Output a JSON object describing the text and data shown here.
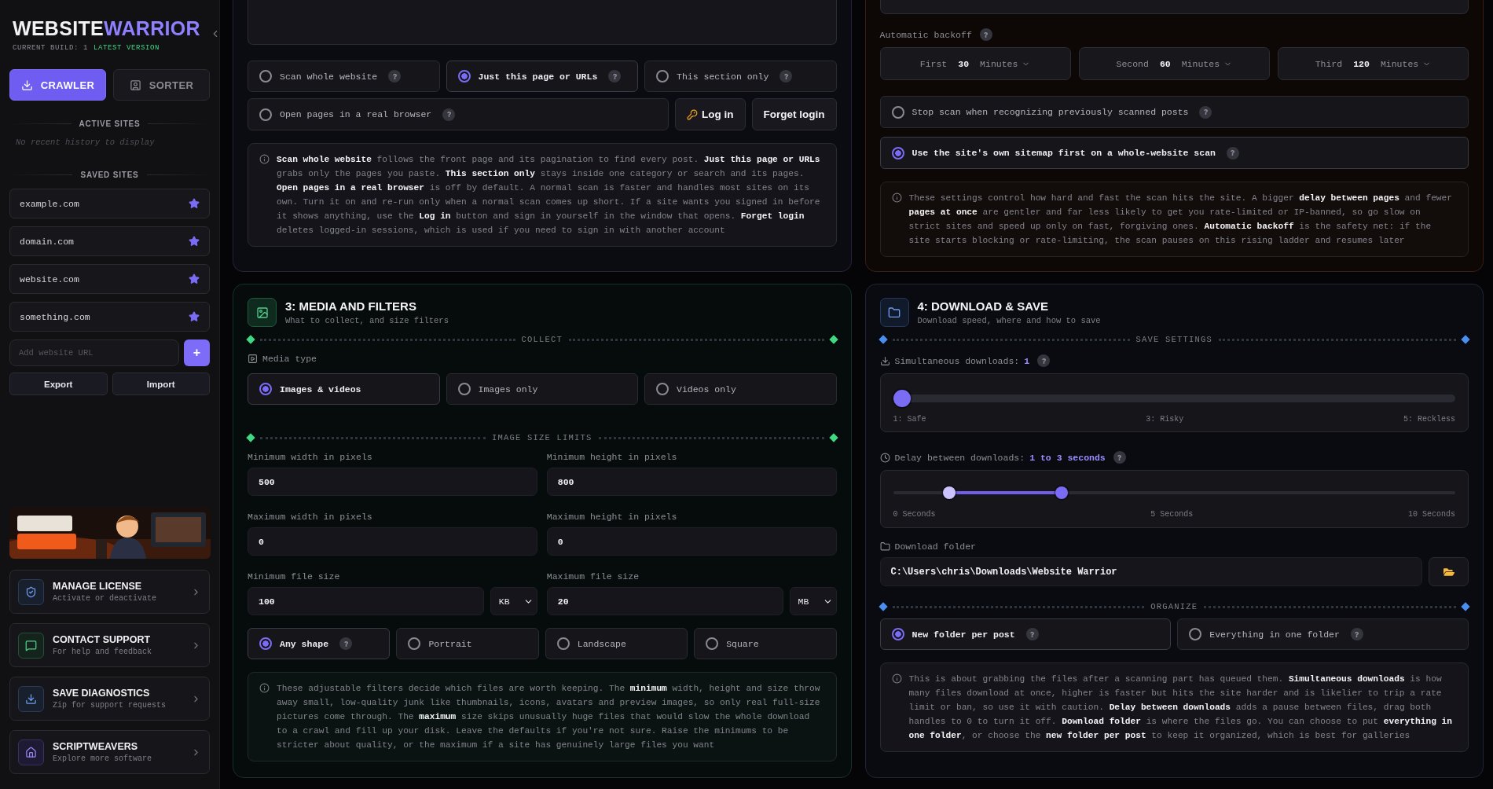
{
  "sidebar": {
    "brand": {
      "first": "WEBSITE",
      "second": "WARRIOR"
    },
    "build": {
      "label": "CURRENT BUILD: 1",
      "status": "LATEST VERSION"
    },
    "modes": [
      {
        "label": "CRAWLER",
        "kind": "crawler",
        "selected": true
      },
      {
        "label": "SORTER",
        "kind": "sorter",
        "selected": false
      }
    ],
    "active_sites": {
      "heading": "ACTIVE SITES",
      "empty_message": "No recent history to display"
    },
    "saved_sites": {
      "heading": "SAVED SITES",
      "items": [
        {
          "name": "example.com"
        },
        {
          "name": "domain.com"
        },
        {
          "name": "website.com"
        },
        {
          "name": "something.com"
        }
      ]
    },
    "add_site": {
      "placeholder": "Add website URL",
      "button": "+"
    },
    "actions": [
      "Export",
      "Import"
    ],
    "links": [
      {
        "kind": "license",
        "title": "MANAGE LICENSE",
        "subtitle": "Activate or deactivate"
      },
      {
        "kind": "support",
        "title": "CONTACT SUPPORT",
        "subtitle": "For help and feedback"
      },
      {
        "kind": "diagnostics",
        "title": "SAVE DIAGNOSTICS",
        "subtitle": "Zip for support requests"
      },
      {
        "kind": "home",
        "title": "SCRIPTWEAVERS",
        "subtitle": "Explore more software"
      }
    ]
  },
  "scan_panel": {
    "scopes": [
      {
        "label": "Scan whole website",
        "selected": false
      },
      {
        "label": "Just this page or URLs",
        "selected": true
      },
      {
        "label": "This section only",
        "selected": false
      }
    ],
    "browser_option": {
      "label": "Open pages in a real browser",
      "checked": false
    },
    "buttons": [
      {
        "kind": "login",
        "label": "Log in"
      },
      {
        "kind": "plain",
        "label": "Forget login"
      }
    ],
    "info": "**Scan whole website** follows the front page and its pagination to find every post. **Just this page or URLs** grabs only the pages you paste. **This section only** stays inside one category or search and its pages. **Open pages in a real browser** is off by default. A normal scan is faster and handles most sites on its own. Turn it on and re-run only when a normal scan comes up short. If a site wants you signed in before it shows anything, use the **Log in** button and sign in yourself in the window that opens. **Forget login** deletes logged-in sessions, which is used if you need to sign in with another account"
  },
  "speed_panel": {
    "backoff": {
      "label": "Automatic backoff",
      "steps": [
        {
          "label": "First",
          "value": "30",
          "unit": "Minutes"
        },
        {
          "label": "Second",
          "value": "60",
          "unit": "Minutes"
        },
        {
          "label": "Third",
          "value": "120",
          "unit": "Minutes"
        }
      ]
    },
    "options": [
      {
        "label": "Stop scan when recognizing previously scanned posts",
        "checked": false
      },
      {
        "label": "Use the site's own sitemap first on a whole-website scan",
        "checked": true
      }
    ],
    "info": "These settings control how hard and fast the scan hits the site. A bigger **delay between pages** and fewer **pages at once** are gentler and far less likely to get you rate-limited or IP-banned, so go slow on strict sites and speed up only on fast, forgiving ones. **Automatic backoff** is the safety net: if the site starts blocking or rate-limiting, the scan pauses on this rising ladder and resumes later"
  },
  "media_panel": {
    "title": "3: MEDIA AND FILTERS",
    "subtitle": "What to collect, and size filters",
    "collect_heading": "COLLECT",
    "media_type": {
      "label": "Media type",
      "options": [
        {
          "label": "Images & videos",
          "selected": true
        },
        {
          "label": "Images only",
          "selected": false
        },
        {
          "label": "Videos only",
          "selected": false
        }
      ]
    },
    "size_heading": "IMAGE SIZE LIMITS",
    "fields": [
      {
        "label": "Minimum width in pixels",
        "value": "500"
      },
      {
        "label": "Minimum height in pixels",
        "value": "800"
      },
      {
        "label": "Maximum width in pixels",
        "value": "0"
      },
      {
        "label": "Maximum height in pixels",
        "value": "0"
      },
      {
        "label": "Minimum file size",
        "value": "100",
        "unit": "KB"
      },
      {
        "label": "Maximum file size",
        "value": "20",
        "unit": "MB"
      }
    ],
    "shapes": [
      {
        "label": "Any shape",
        "selected": true,
        "help": true
      },
      {
        "label": "Portrait",
        "selected": false,
        "help": false
      },
      {
        "label": "Landscape",
        "selected": false,
        "help": false
      },
      {
        "label": "Square",
        "selected": false,
        "help": false
      }
    ],
    "info": "These adjustable filters decide which files are worth keeping. The **minimum** width, height and size throw away small, low-quality junk like thumbnails, icons, avatars and preview images, so only real full-size pictures come through. The **maximum** size skips unusually huge files that would slow the whole download to a crawl and fill up your disk. Leave the defaults if you're not sure. Raise the minimums to be stricter about quality, or the maximum if a site has genuinely large files you want"
  },
  "download_panel": {
    "title": "4: DOWNLOAD & SAVE",
    "subtitle": "Download speed, where and how to save",
    "save_heading": "SAVE SETTINGS",
    "simultaneous": {
      "label": "Simultaneous downloads:",
      "value": "1",
      "level": 0,
      "ticks": [
        "1: Safe",
        "3: Risky",
        "5: Reckless"
      ]
    },
    "delay": {
      "label": "Delay between downloads:",
      "value": "1 to 3 seconds",
      "low": {
        "level": 0.1
      },
      "high": {
        "level": 0.3
      },
      "ticks": [
        "0 Seconds",
        "5 Seconds",
        "10 Seconds"
      ]
    },
    "folder": {
      "label": "Download folder",
      "value": "C:\\Users\\chris\\Downloads\\Website Warrior"
    },
    "organize_heading": "ORGANIZE",
    "organize": [
      {
        "label": "New folder per post",
        "selected": true
      },
      {
        "label": "Everything in one folder",
        "selected": false
      }
    ],
    "info": "This is about grabbing the files after a scanning part has queued them. **Simultaneous downloads** is how many files download at once, higher is faster but hits the site harder and is likelier to trip a rate limit or ban, so use it with caution. **Delay between downloads** adds a pause between files, drag both handles to 0 to turn it off. **Download folder** is where the files go. You can choose to put **everything in one folder**, or choose the **new folder per post** to keep it organized, which is best for galleries"
  }
}
